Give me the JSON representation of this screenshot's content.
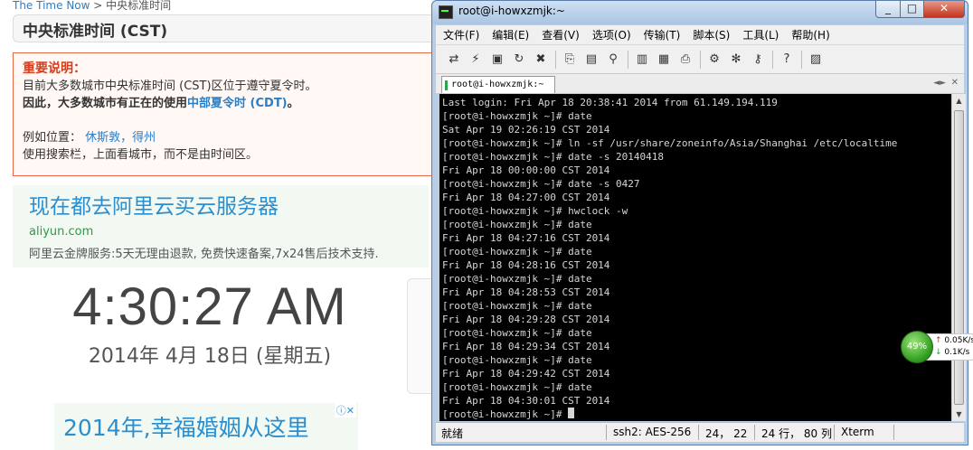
{
  "web": {
    "breadcrumb_link": "The Time Now",
    "breadcrumb_sep": ">",
    "breadcrumb_current": "中央标准时间",
    "tz_title": "中央标准时间 (CST)",
    "notice": {
      "heading": "重要说明：",
      "line1": "目前大多数城市中央标准时间 (CST)区位于遵守夏令时。",
      "line2_prefix": "因此，大多数城市有正在的使用",
      "line2_link": "中部夏令时 (CDT)",
      "line2_suffix": "。",
      "example_label": "例如位置：",
      "example_links": "休斯敦，得州",
      "line4": "使用搜索栏，上面看城市，而不是由时间区。"
    },
    "ad1": {
      "title": "现在都去阿里云买云服务器",
      "url": "aliyun.com",
      "desc": "阿里云金牌服务:5天无理由退款, 免费快速备案,7x24售后技术支持."
    },
    "clock": "4:30:27 AM",
    "date": "2014年 4月 18日 (星期五)",
    "ad2": {
      "title": "2014年,幸福婚姻从这里",
      "adchoice": "ⓘ✕"
    }
  },
  "terminal": {
    "window_title": "root@i-howxzmjk:~",
    "menu": [
      "文件(F)",
      "编辑(E)",
      "查看(V)",
      "选项(O)",
      "传输(T)",
      "脚本(S)",
      "工具(L)",
      "帮助(H)"
    ],
    "tab_label": "root@i-howxzmjk:~",
    "lines": [
      "Last login: Fri Apr 18 20:38:41 2014 from 61.149.194.119",
      "[root@i-howxzmjk ~]# date",
      "Sat Apr 19 02:26:19 CST 2014",
      "[root@i-howxzmjk ~]# ln -sf /usr/share/zoneinfo/Asia/Shanghai /etc/localtime",
      "[root@i-howxzmjk ~]# date -s 20140418",
      "Fri Apr 18 00:00:00 CST 2014",
      "[root@i-howxzmjk ~]# date -s 0427",
      "Fri Apr 18 04:27:00 CST 2014",
      "[root@i-howxzmjk ~]# hwclock -w",
      "[root@i-howxzmjk ~]# date",
      "Fri Apr 18 04:27:16 CST 2014",
      "[root@i-howxzmjk ~]# date",
      "Fri Apr 18 04:28:16 CST 2014",
      "[root@i-howxzmjk ~]# date",
      "Fri Apr 18 04:28:53 CST 2014",
      "[root@i-howxzmjk ~]# date",
      "Fri Apr 18 04:29:28 CST 2014",
      "[root@i-howxzmjk ~]# date",
      "Fri Apr 18 04:29:34 CST 2014",
      "[root@i-howxzmjk ~]# date",
      "Fri Apr 18 04:29:42 CST 2014",
      "[root@i-howxzmjk ~]# date",
      "Fri Apr 18 04:30:01 CST 2014"
    ],
    "prompt": "[root@i-howxzmjk ~]# ",
    "status": {
      "ready": "就绪",
      "protocol": "ssh2: AES-256",
      "position": "24， 22",
      "size": "24 行， 80 列",
      "term_type": "Xterm"
    }
  },
  "net_widget": {
    "percent": "49%",
    "up": "0.05K/s",
    "down": "0.1K/s"
  },
  "colors": {
    "accent_link": "#2a7fc9",
    "notice_border": "#e8684a",
    "terminal_bg": "#000000",
    "terminal_fg": "#d6d6d6"
  }
}
